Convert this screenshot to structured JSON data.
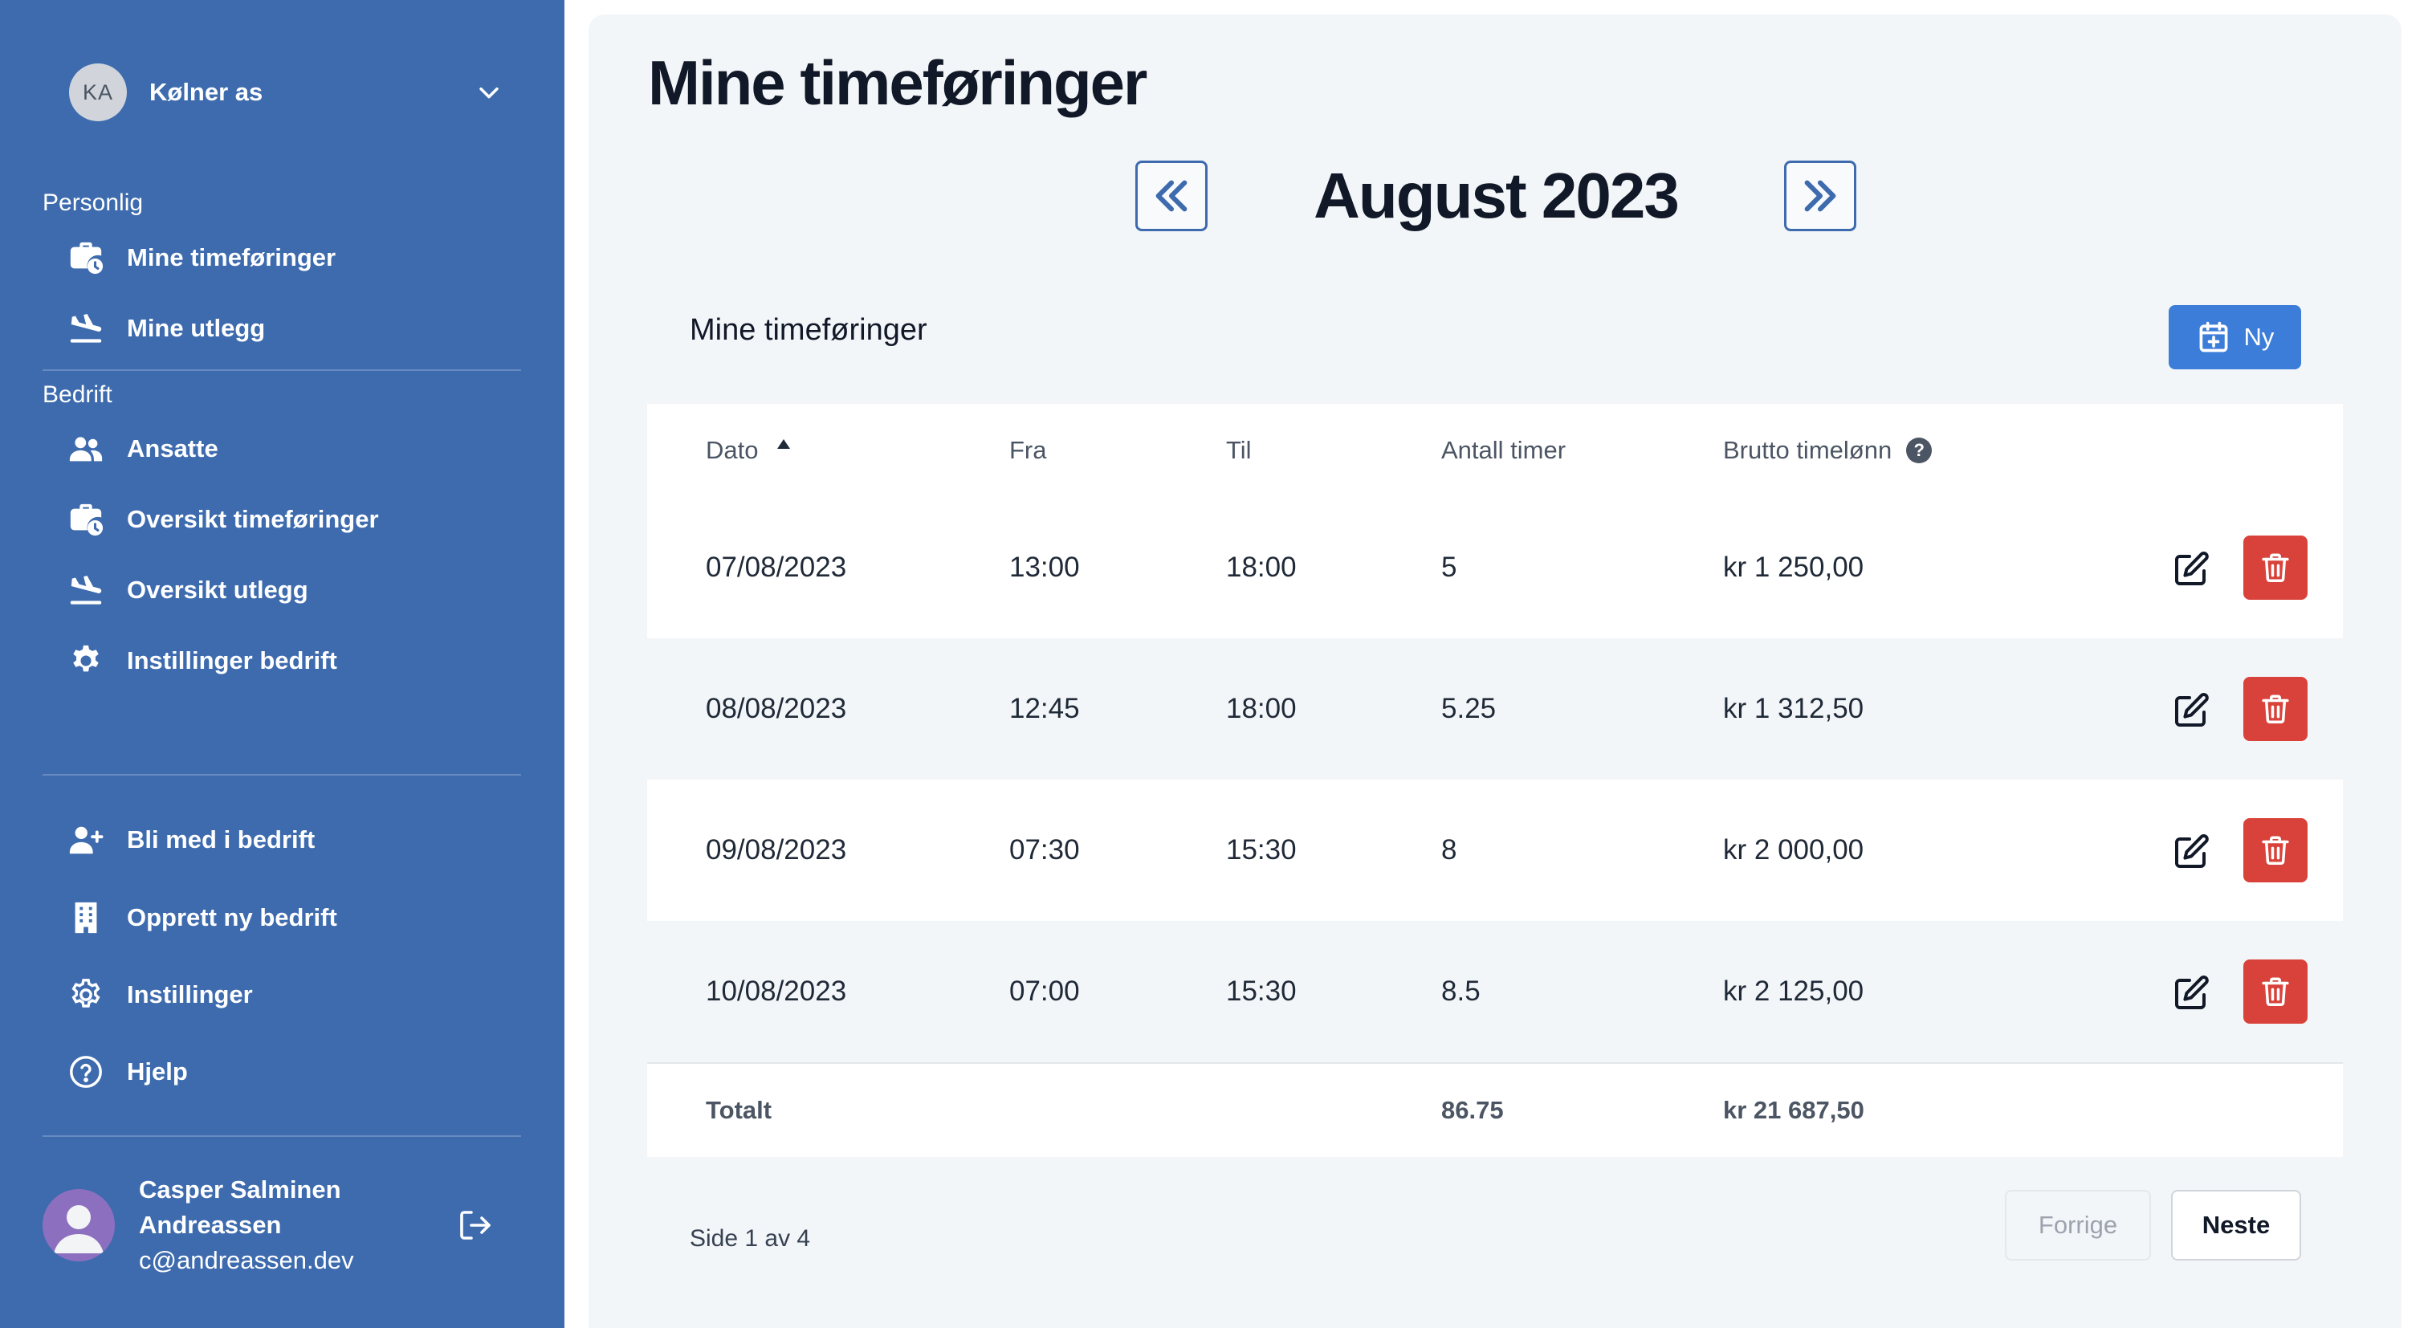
{
  "sidebar": {
    "org": {
      "initials": "KA",
      "name": "Kølner as"
    },
    "sections": {
      "personal": "Personlig",
      "company": "Bedrift"
    },
    "personal_items": [
      {
        "label": "Mine timeføringer",
        "icon": "briefcase-clock-icon"
      },
      {
        "label": "Mine utlegg",
        "icon": "plane-landing-icon"
      }
    ],
    "company_items": [
      {
        "label": "Ansatte",
        "icon": "users-icon"
      },
      {
        "label": "Oversikt timeføringer",
        "icon": "briefcase-clock-icon"
      },
      {
        "label": "Oversikt utlegg",
        "icon": "plane-landing-icon"
      },
      {
        "label": "Instillinger bedrift",
        "icon": "gear-solid-icon"
      }
    ],
    "bottom_items": [
      {
        "label": "Bli med i bedrift",
        "icon": "user-plus-icon"
      },
      {
        "label": "Opprett ny bedrift",
        "icon": "building-icon"
      },
      {
        "label": "Instillinger",
        "icon": "gear-outline-icon"
      },
      {
        "label": "Hjelp",
        "icon": "question-circle-icon"
      }
    ],
    "user": {
      "name": "Casper Salminen Andreassen",
      "email": "c@andreassen.dev"
    }
  },
  "main": {
    "page_title": "Mine timeføringer",
    "month_label": "August 2023",
    "card_title": "Mine timeføringer",
    "new_button": "Ny",
    "table": {
      "headers": {
        "date": "Dato",
        "from": "Fra",
        "to": "Til",
        "hours": "Antall timer",
        "pay": "Brutto timelønn"
      },
      "rows": [
        {
          "date": "07/08/2023",
          "from": "13:00",
          "to": "18:00",
          "hours": "5",
          "pay": "kr 1 250,00"
        },
        {
          "date": "08/08/2023",
          "from": "12:45",
          "to": "18:00",
          "hours": "5.25",
          "pay": "kr 1 312,50"
        },
        {
          "date": "09/08/2023",
          "from": "07:30",
          "to": "15:30",
          "hours": "8",
          "pay": "kr 2 000,00"
        },
        {
          "date": "10/08/2023",
          "from": "07:00",
          "to": "15:30",
          "hours": "8.5",
          "pay": "kr 2 125,00"
        }
      ],
      "total": {
        "label": "Totalt",
        "hours": "86.75",
        "pay": "kr 21 687,50"
      }
    },
    "pagination": {
      "text": "Side 1 av 4",
      "prev": "Forrige",
      "next": "Neste"
    }
  },
  "colors": {
    "sidebar_bg": "#3d6bae",
    "main_bg": "#f3f6f9",
    "primary": "#3c7dd9",
    "danger": "#d9423a"
  }
}
